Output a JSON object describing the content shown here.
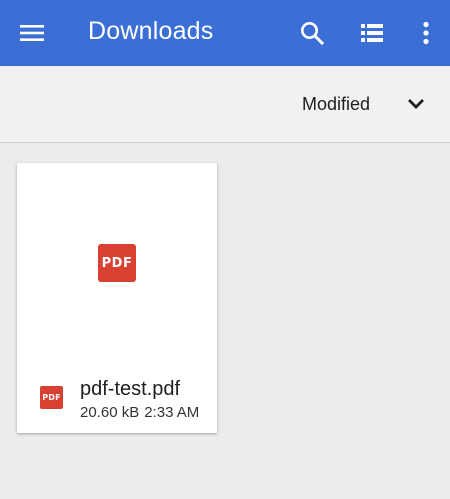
{
  "appbar": {
    "title": "Downloads",
    "menu_icon": "hamburger-menu-icon",
    "search_icon": "search-icon",
    "view_icon": "list-view-icon",
    "more_icon": "more-vertical-icon",
    "color": "#3c6fd6"
  },
  "sortbar": {
    "sort_label": "Modified",
    "toggle_icon": "chevron-down-icon"
  },
  "files": [
    {
      "name": "pdf-test.pdf",
      "size": "20.60 kB",
      "time": "2:33 AM",
      "type_badge": "PDF",
      "badge_color": "#d84132"
    }
  ]
}
